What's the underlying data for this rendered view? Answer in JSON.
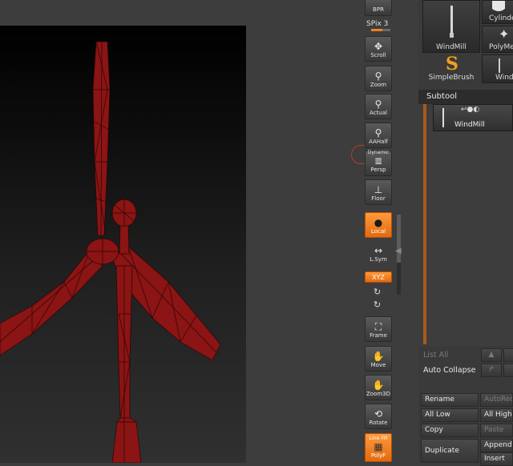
{
  "viewport": {
    "label": "3D viewport",
    "model_color": "#8b1414",
    "wire_color": "#2a0505"
  },
  "shelf": {
    "bpr": "BPR",
    "spix": "SPix 3",
    "spix_level": 0.6,
    "buttons": [
      {
        "id": "scroll",
        "label": "Scroll",
        "icon": "scroll-icon",
        "glyph": "✥",
        "active": false
      },
      {
        "id": "zoom",
        "label": "Zoom",
        "icon": "zoom-icon",
        "glyph": "⚲",
        "active": false
      },
      {
        "id": "actual",
        "label": "Actual",
        "icon": "actual-icon",
        "glyph": "⚲",
        "active": false
      },
      {
        "id": "aahalf",
        "label": "AAHalf",
        "icon": "aahalf-icon",
        "glyph": "⚲",
        "active": false
      },
      {
        "id": "persp",
        "label": "Persp",
        "icon": "persp-icon",
        "glyph": "≣",
        "active": false,
        "top_label": "Dynamic"
      },
      {
        "id": "floor",
        "label": "Floor",
        "icon": "floor-icon",
        "glyph": "⊥",
        "active": false
      },
      {
        "id": "local",
        "label": "Local",
        "icon": "local-icon",
        "glyph": "●",
        "active": true
      },
      {
        "id": "lsym",
        "label": "L.Sym",
        "icon": "lsym-icon",
        "glyph": "↔",
        "active": false
      },
      {
        "id": "xyz",
        "label": "XYZ",
        "icon": "xyz-icon",
        "glyph": "",
        "active": true
      },
      {
        "id": "frame",
        "label": "Frame",
        "icon": "frame-icon",
        "glyph": "⛶",
        "active": false
      },
      {
        "id": "move",
        "label": "Move",
        "icon": "move-icon",
        "glyph": "✋",
        "active": false
      },
      {
        "id": "zoom3d",
        "label": "Zoom3D",
        "icon": "zoom3d-icon",
        "glyph": "✋",
        "active": false
      },
      {
        "id": "rotate",
        "label": "Rotate",
        "icon": "rotate-icon",
        "glyph": "⟲",
        "active": false
      },
      {
        "id": "polyf",
        "label": "PolyF",
        "icon": "polyf-icon",
        "glyph": "▦",
        "active": true,
        "top_label": "Line Fill"
      }
    ]
  },
  "tool_palette": {
    "thumbs": [
      {
        "label": "WindMill",
        "icon": "windmill-icon"
      },
      {
        "label": "Cylinde",
        "icon": "cylinder-icon"
      },
      {
        "label": "PolyMe",
        "icon": "polymesh-icon"
      },
      {
        "label": "SimpleBrush",
        "icon": "simplebrush-icon"
      },
      {
        "label": "Wind",
        "icon": "windmill-icon"
      }
    ],
    "subtool": {
      "title": "Subtool",
      "item_label": "WindMill",
      "list_all": "List All",
      "auto_collapse": "Auto Collapse",
      "rename": "Rename",
      "auto_reorder": "AutoReo",
      "all_low": "All Low",
      "all_high": "All High",
      "copy": "Copy",
      "paste": "Paste",
      "duplicate": "Duplicate",
      "append": "Append",
      "insert": "Insert"
    }
  }
}
